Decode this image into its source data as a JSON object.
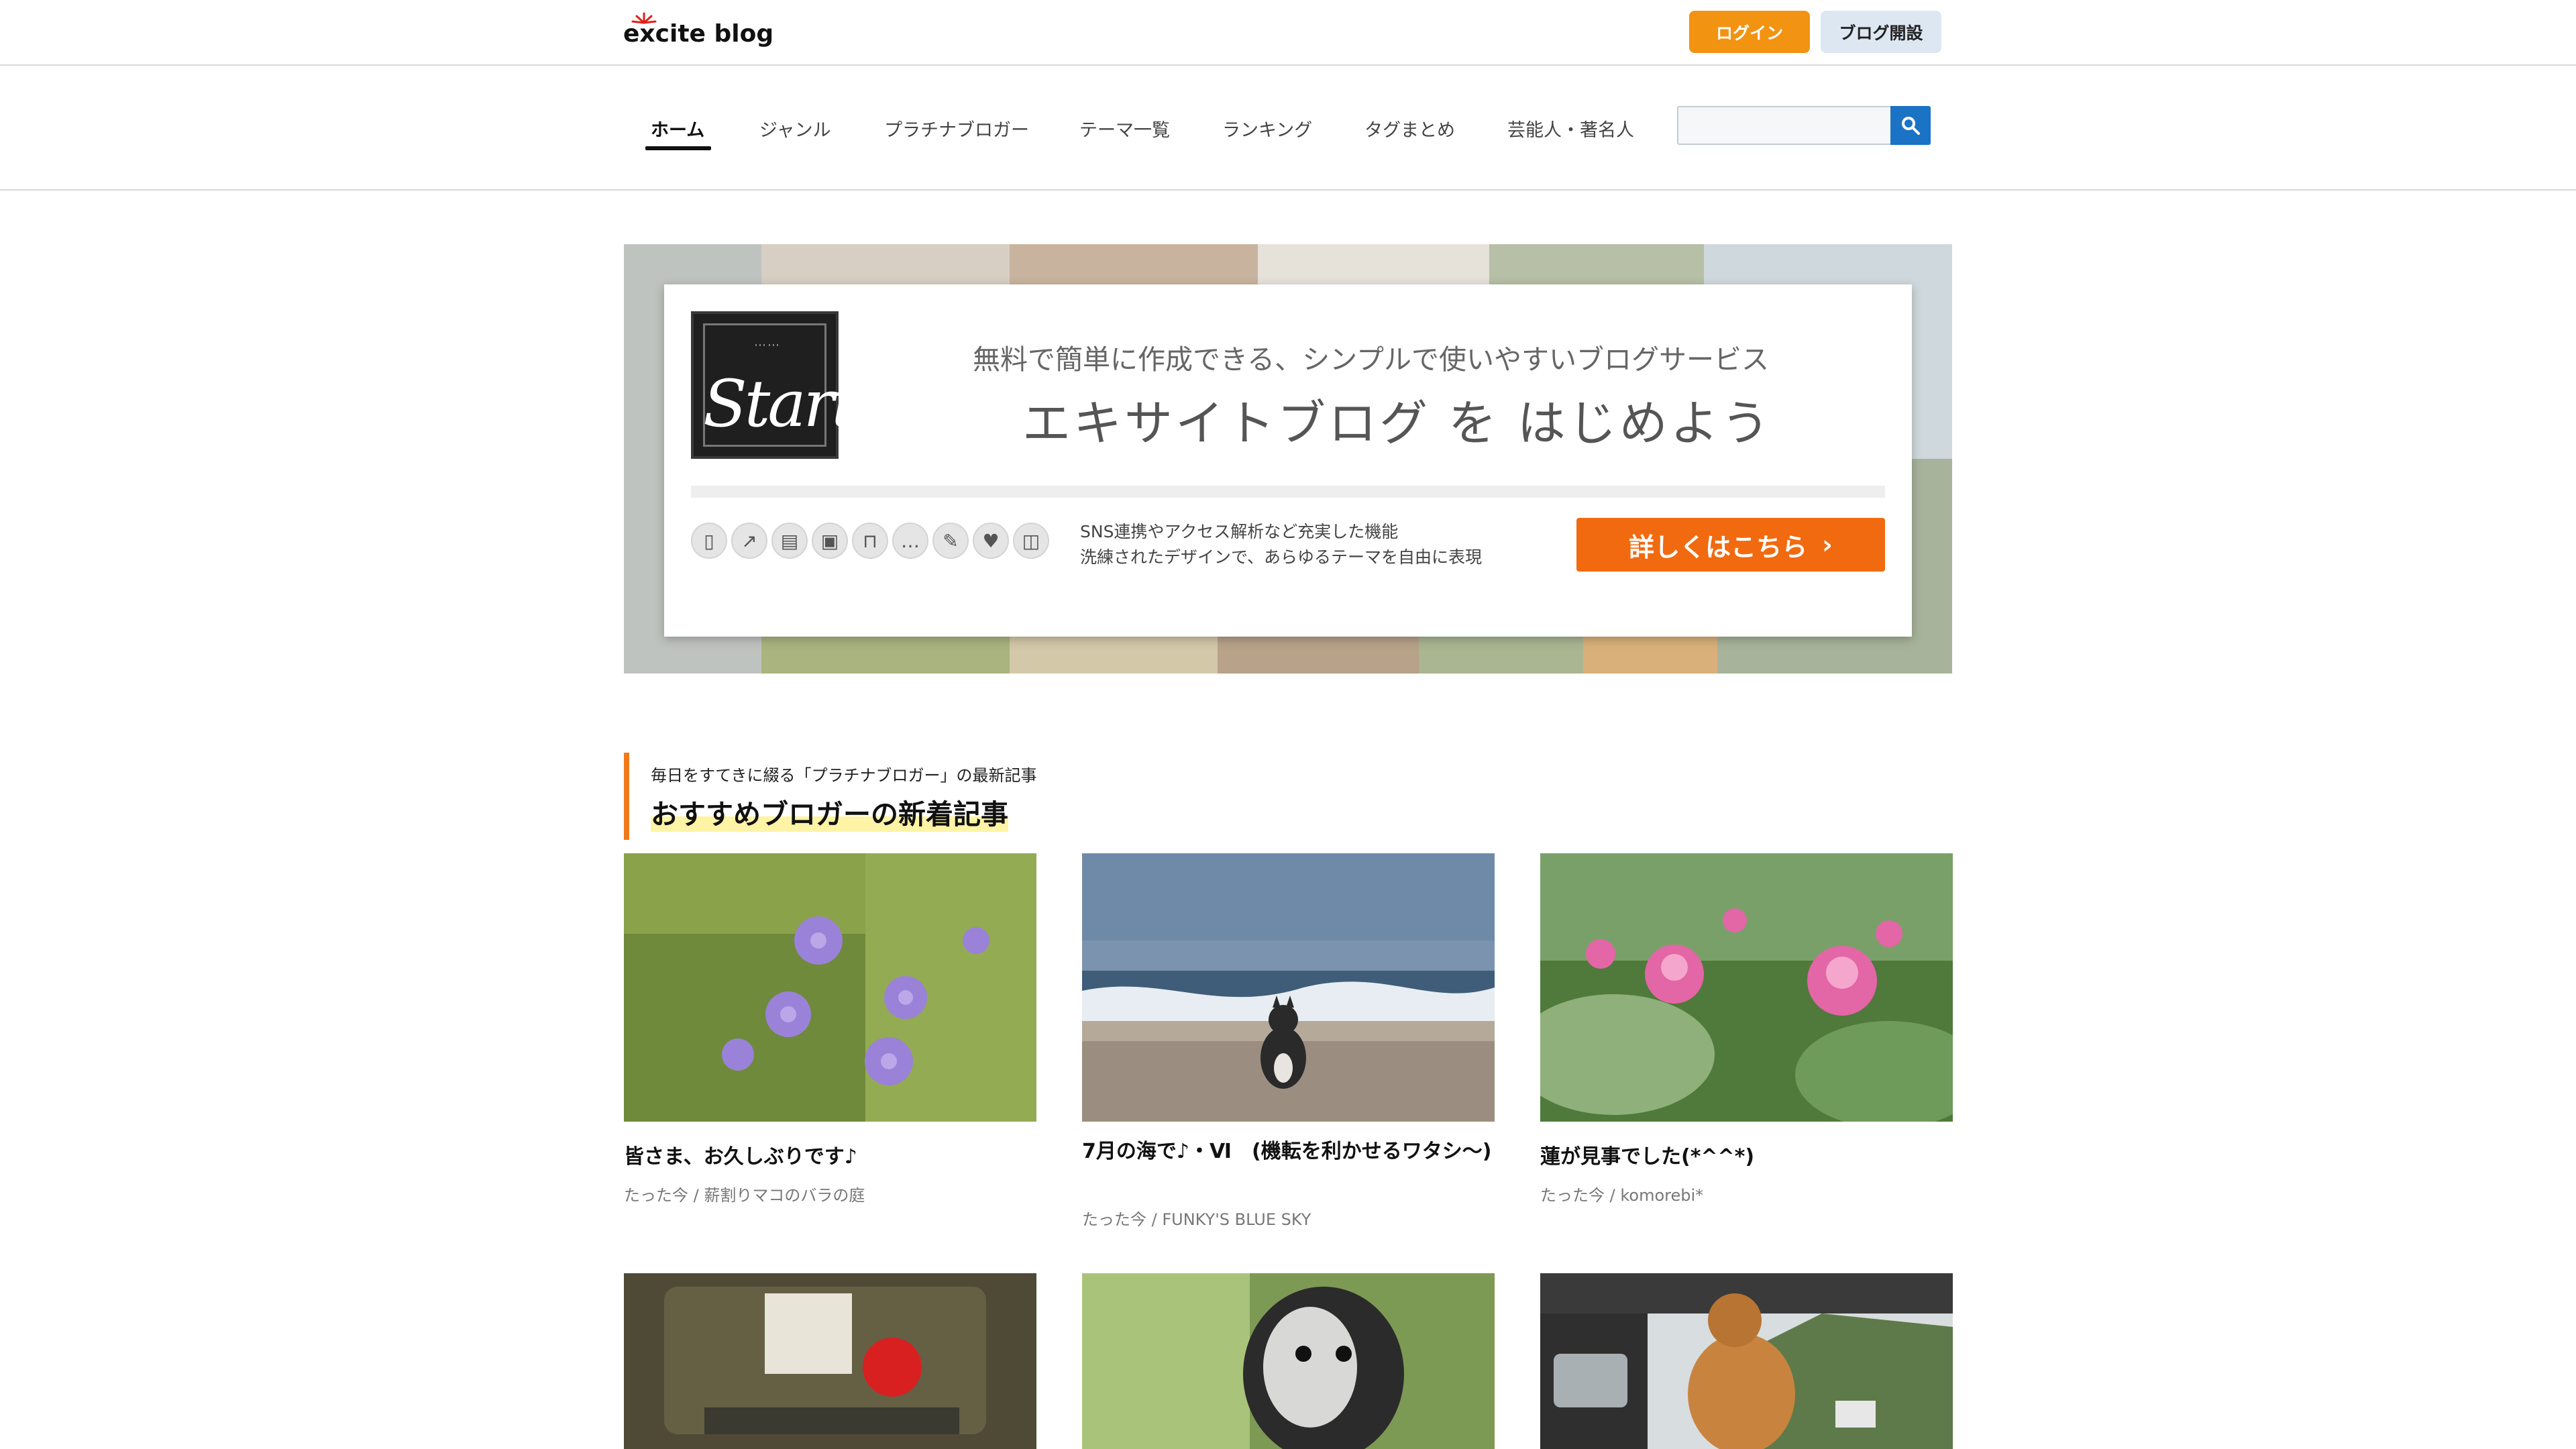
{
  "header": {
    "logo_text": "excite blog",
    "login_label": "ログイン",
    "open_blog_label": "ブログ開設"
  },
  "nav": {
    "items": [
      {
        "label": "ホーム"
      },
      {
        "label": "ジャンル"
      },
      {
        "label": "プラチナブロガー"
      },
      {
        "label": "テーマ一覧"
      },
      {
        "label": "ランキング"
      },
      {
        "label": "タグまとめ"
      },
      {
        "label": "芸能人・著名人"
      }
    ],
    "active_index": 0,
    "search_placeholder": ""
  },
  "banner": {
    "start_text": "Start",
    "subtitle": "無料で簡単に作成できる、シンプルで使いやすいブログサービス",
    "title": "エキサイトブログ を はじめよう",
    "features_line1": "SNS連携やアクセス解析など充実した機能",
    "features_line2": "洗練されたデザインで、あらゆるテーマを自由に表現",
    "cta_label": "詳しくはこちら",
    "feature_icons": [
      "mobile-icon",
      "analytics-icon",
      "layout-icon",
      "image-icon",
      "lock-icon",
      "comment-icon",
      "edit-icon",
      "heart-icon",
      "book-icon"
    ]
  },
  "section": {
    "subtitle": "毎日をすてきに綴る「プラチナブロガー」の最新記事",
    "title": "おすすめブロガーの新着記事"
  },
  "articles": [
    {
      "title": "皆さま、お久しぶりです♪",
      "meta": "たった今 / 薪割りマコのバラの庭"
    },
    {
      "title": "7月の海で♪・Ⅵ　(機転を利かせるワタシ～)",
      "meta": "たった今 / FUNKY'S BLUE SKY"
    },
    {
      "title": "蓮が見事でした(*^^*)",
      "meta": "たった今 / komorebi*"
    },
    {
      "title": "",
      "meta": ""
    },
    {
      "title": "",
      "meta": ""
    },
    {
      "title": "",
      "meta": ""
    }
  ],
  "colors": {
    "accent_orange": "#f29312",
    "cta_orange": "#f26a0f",
    "search_blue": "#1a73c5",
    "section_bar": "#f07a1a"
  }
}
